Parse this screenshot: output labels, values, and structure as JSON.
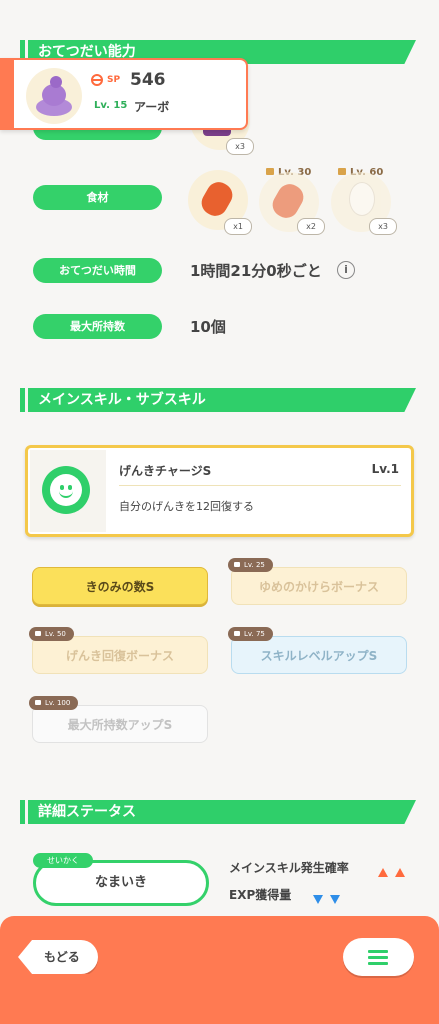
{
  "sections": {
    "help": "おてつだい能力",
    "skills": "メインスキル・サブスキル",
    "details": "詳細ステータス"
  },
  "pokemon_card": {
    "sp_label": "SP",
    "sp_value": "546",
    "level": "Lv. 15",
    "name": "アーボ"
  },
  "berries": {
    "qty": "x3"
  },
  "ingredients": {
    "label": "食材",
    "items": [
      {
        "qty": "x1",
        "lock_level": ""
      },
      {
        "qty": "x2",
        "lock_level": "Lv. 30"
      },
      {
        "qty": "x3",
        "lock_level": "Lv. 60"
      }
    ]
  },
  "help_time": {
    "label": "おてつだい時間",
    "value": "1時間21分0秒ごと",
    "info_icon": "i"
  },
  "max_carry": {
    "label": "最大所持数",
    "value": "10個"
  },
  "main_skill": {
    "name": "げんきチャージS",
    "level": "Lv.1",
    "description": "自分のげんきを12回復する"
  },
  "sub_skills": [
    {
      "label": "きのみの数S",
      "lock": ""
    },
    {
      "label": "ゆめのかけらボーナス",
      "lock": "Lv. 25"
    },
    {
      "label": "げんき回復ボーナス",
      "lock": "Lv. 50"
    },
    {
      "label": "スキルレベルアップS",
      "lock": "Lv. 75"
    },
    {
      "label": "最大所持数アップS",
      "lock": "Lv. 100"
    }
  ],
  "nature": {
    "tag": "せいかく",
    "value": "なまいき"
  },
  "nature_effects": [
    {
      "label": "メインスキル発生確率",
      "direction": "up",
      "color": "#ff6a3d"
    },
    {
      "label": "EXP獲得量",
      "direction": "down",
      "color": "#2f8ee8"
    }
  ],
  "footer": {
    "back_label": "もどる",
    "menu_icon": "hamburger-icon"
  },
  "colors": {
    "green": "#2fcf6a",
    "orange": "#ff7a52",
    "gold": "#f4c84a"
  }
}
